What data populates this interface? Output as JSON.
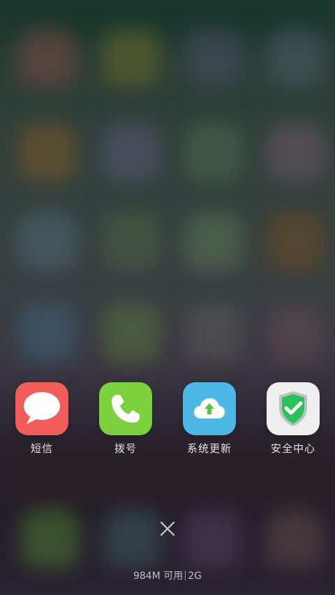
{
  "recent_apps": [
    {
      "label": "短信",
      "icon": "message-bubble-icon",
      "color": "#f25d5a"
    },
    {
      "label": "拨号",
      "icon": "phone-handset-icon",
      "color": "#7ed13e"
    },
    {
      "label": "系统更新",
      "icon": "cloud-upload-icon",
      "color": "#4db8e6"
    },
    {
      "label": "安全中心",
      "icon": "shield-check-icon",
      "color": "#eeeeee"
    }
  ],
  "close_all": {
    "icon": "close-icon"
  },
  "memory": {
    "available": "984M 可用",
    "total": "2G"
  }
}
